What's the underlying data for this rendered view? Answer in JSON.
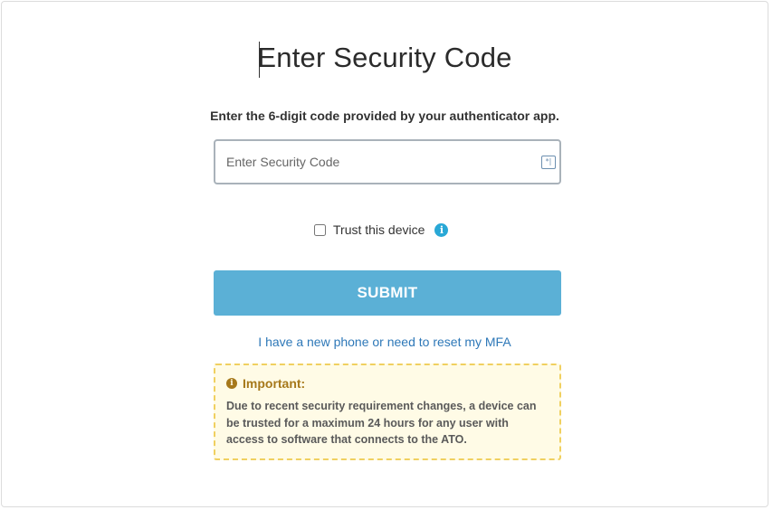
{
  "page": {
    "title": "Enter Security Code",
    "instructions": "Enter the 6-digit code provided by your authenticator app."
  },
  "code_input": {
    "placeholder": "Enter Security Code",
    "value": "",
    "icon": "keypad-icon"
  },
  "trust": {
    "label": "Trust this device",
    "checked": false,
    "info_icon": "info-icon",
    "info_glyph": "i"
  },
  "submit": {
    "label": "SUBMIT"
  },
  "reset_link": {
    "label": "I have a new phone or need to reset my MFA"
  },
  "notice": {
    "heading": "Important:",
    "icon": "info-icon",
    "body": "Due to recent security requirement changes, a device can be trusted for a maximum 24 hours for any user with access to software that connects to the ATO."
  },
  "colors": {
    "submit_bg": "#5bb0d6",
    "link": "#2e78b8",
    "info": "#29a8d6",
    "notice_border": "#f0d060",
    "notice_bg": "#fffbe6",
    "notice_heading": "#a6781a"
  }
}
